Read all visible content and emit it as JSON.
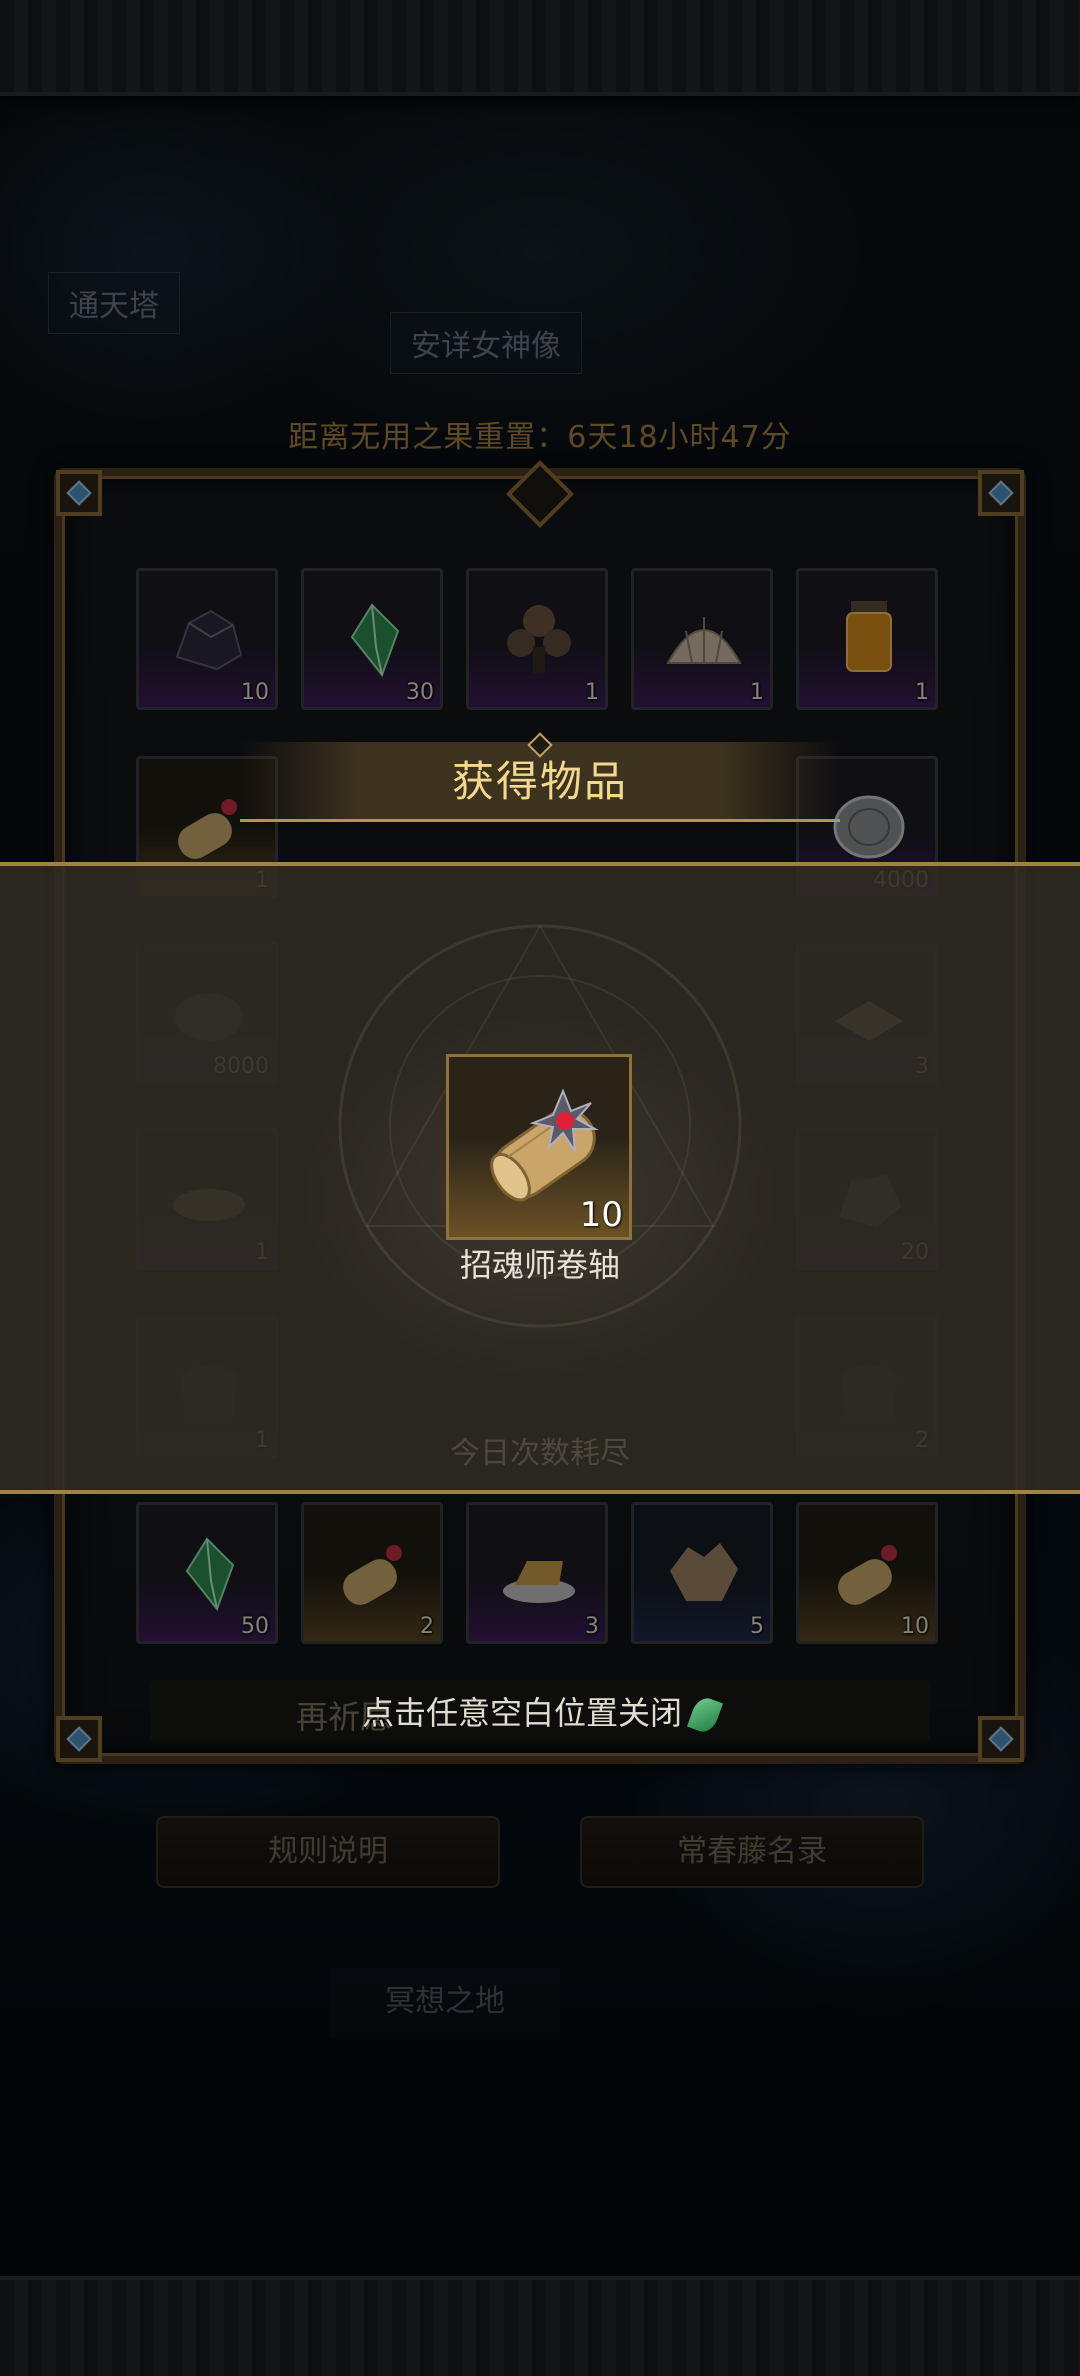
{
  "background": {
    "tower_label": "通天塔",
    "statue_label": "安详女神像",
    "reset_countdown": "距离无用之果重置：6天18小时47分",
    "meditation_label": "冥想之地",
    "retry_label": "再祈愿",
    "rules_button": "规则说明",
    "evergreen_button": "常春藤名录",
    "today_text": "今日次数耗尽"
  },
  "grid": {
    "row1": [
      {
        "icon": "ore-icon",
        "qty": "10"
      },
      {
        "icon": "green-crystal-icon",
        "qty": "30"
      },
      {
        "icon": "mushroom-cluster-icon",
        "qty": "1"
      },
      {
        "icon": "shell-icon",
        "qty": "1"
      },
      {
        "icon": "honey-jar-icon",
        "qty": "1"
      }
    ],
    "row2": [
      {
        "icon": "scroll-icon",
        "qty": "1"
      },
      {
        "icon": "silver-coin-icon",
        "qty": "4000"
      }
    ],
    "row3": [
      {
        "icon": "stone-icon",
        "qty": "8000"
      },
      {
        "icon": "cloth-icon",
        "qty": "3"
      }
    ],
    "row4": [
      {
        "icon": "plate-icon",
        "qty": "1"
      },
      {
        "icon": "rock-icon",
        "qty": "20"
      }
    ],
    "row5": [
      {
        "icon": "bag-icon",
        "qty": "1"
      },
      {
        "icon": "bag-icon",
        "qty": "2"
      }
    ],
    "row6": [
      {
        "icon": "green-crystal-icon",
        "qty": "50"
      },
      {
        "icon": "scroll-icon",
        "qty": "2"
      },
      {
        "icon": "cheese-plate-icon",
        "qty": "3"
      },
      {
        "icon": "fur-hide-icon",
        "qty": "5"
      },
      {
        "icon": "scroll-icon",
        "qty": "10"
      }
    ]
  },
  "popup": {
    "title": "获得物品",
    "reward": {
      "icon": "soul-summoner-scroll-icon",
      "qty": "10",
      "name": "招魂师卷轴"
    },
    "close_hint": "点击任意空白位置关闭"
  },
  "colors": {
    "gold_accent": "#b4954f",
    "title_text": "#f3d98e",
    "purple_rarity": "#3b1c55",
    "gold_rarity": "#5a4522",
    "blue_rarity": "#1d2a4a"
  }
}
